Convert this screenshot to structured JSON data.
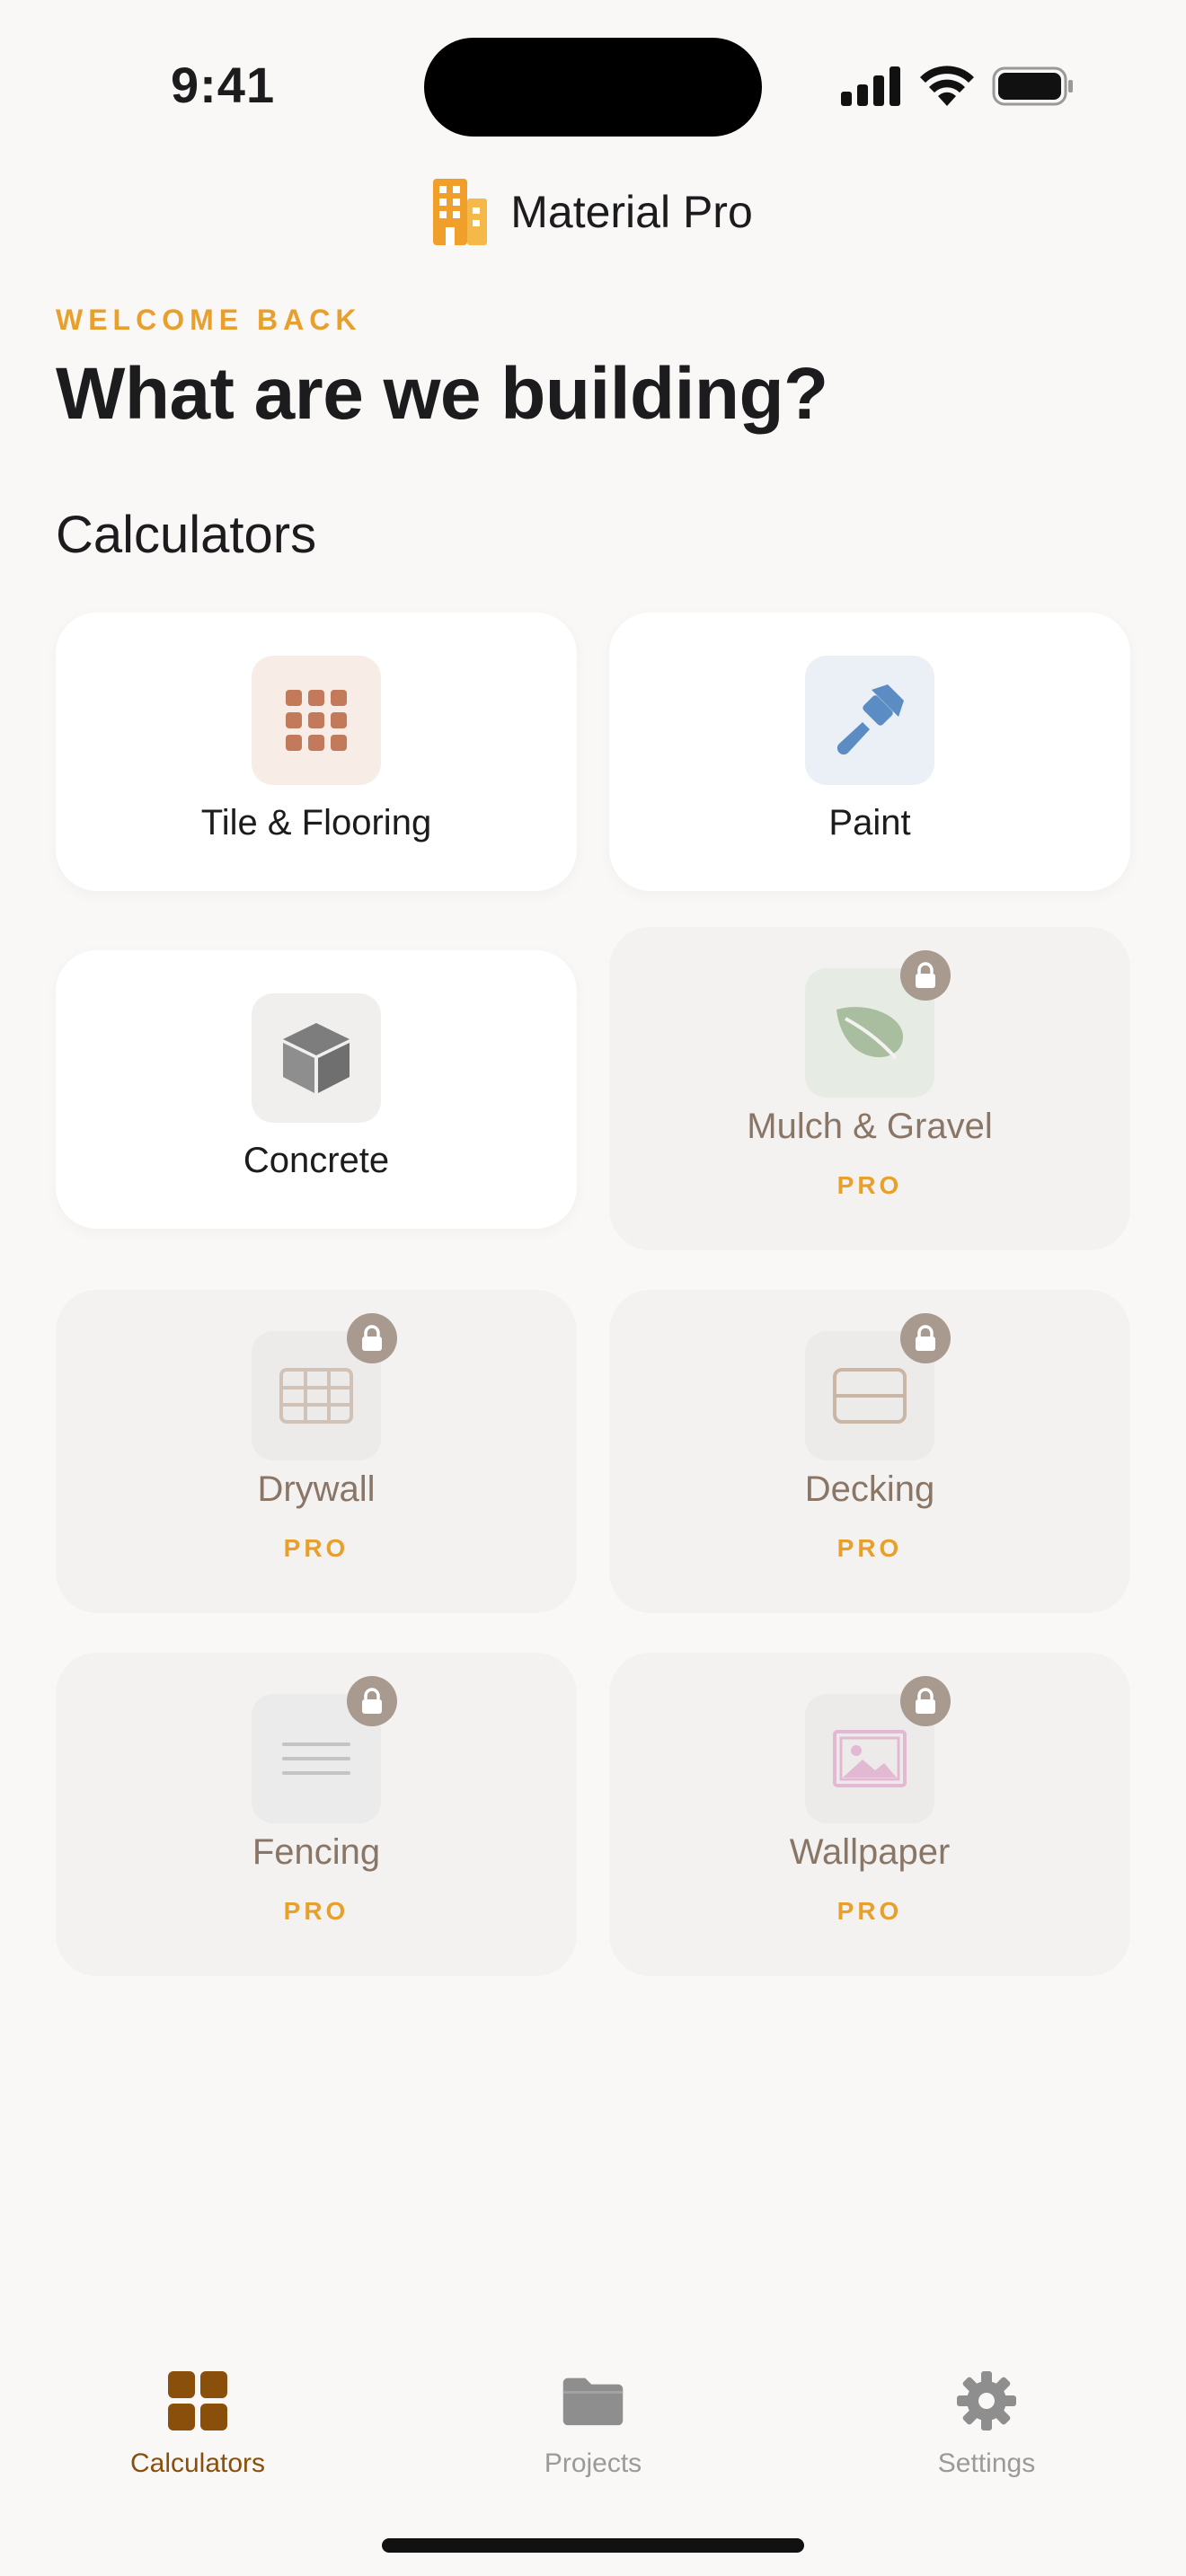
{
  "status": {
    "time": "9:41"
  },
  "header": {
    "app_title": "Material Pro"
  },
  "welcome": "WELCOME BACK",
  "headline": "What are we building?",
  "section_title": "Calculators",
  "calculators": [
    {
      "label": "Tile & Flooring",
      "icon": "tile-grid-icon",
      "locked": false
    },
    {
      "label": "Paint",
      "icon": "paint-brush-icon",
      "locked": false
    },
    {
      "label": "Concrete",
      "icon": "cube-icon",
      "locked": false
    },
    {
      "label": "Mulch & Gravel",
      "icon": "leaf-icon",
      "locked": true,
      "badge": "PRO"
    },
    {
      "label": "Drywall",
      "icon": "drywall-grid-icon",
      "locked": true,
      "badge": "PRO"
    },
    {
      "label": "Decking",
      "icon": "decking-board-icon",
      "locked": true,
      "badge": "PRO"
    },
    {
      "label": "Fencing",
      "icon": "fence-lines-icon",
      "locked": true,
      "badge": "PRO"
    },
    {
      "label": "Wallpaper",
      "icon": "image-frame-icon",
      "locked": true,
      "badge": "PRO"
    }
  ],
  "tabs": [
    {
      "label": "Calculators",
      "icon": "grid-icon",
      "active": true
    },
    {
      "label": "Projects",
      "icon": "folder-icon",
      "active": false
    },
    {
      "label": "Settings",
      "icon": "gear-icon",
      "active": false
    }
  ],
  "colors": {
    "accent": "#e8a02c",
    "active_tab": "#8a4f0a",
    "inactive_tab": "#9a9a9a",
    "locked_label": "#8a7666"
  }
}
